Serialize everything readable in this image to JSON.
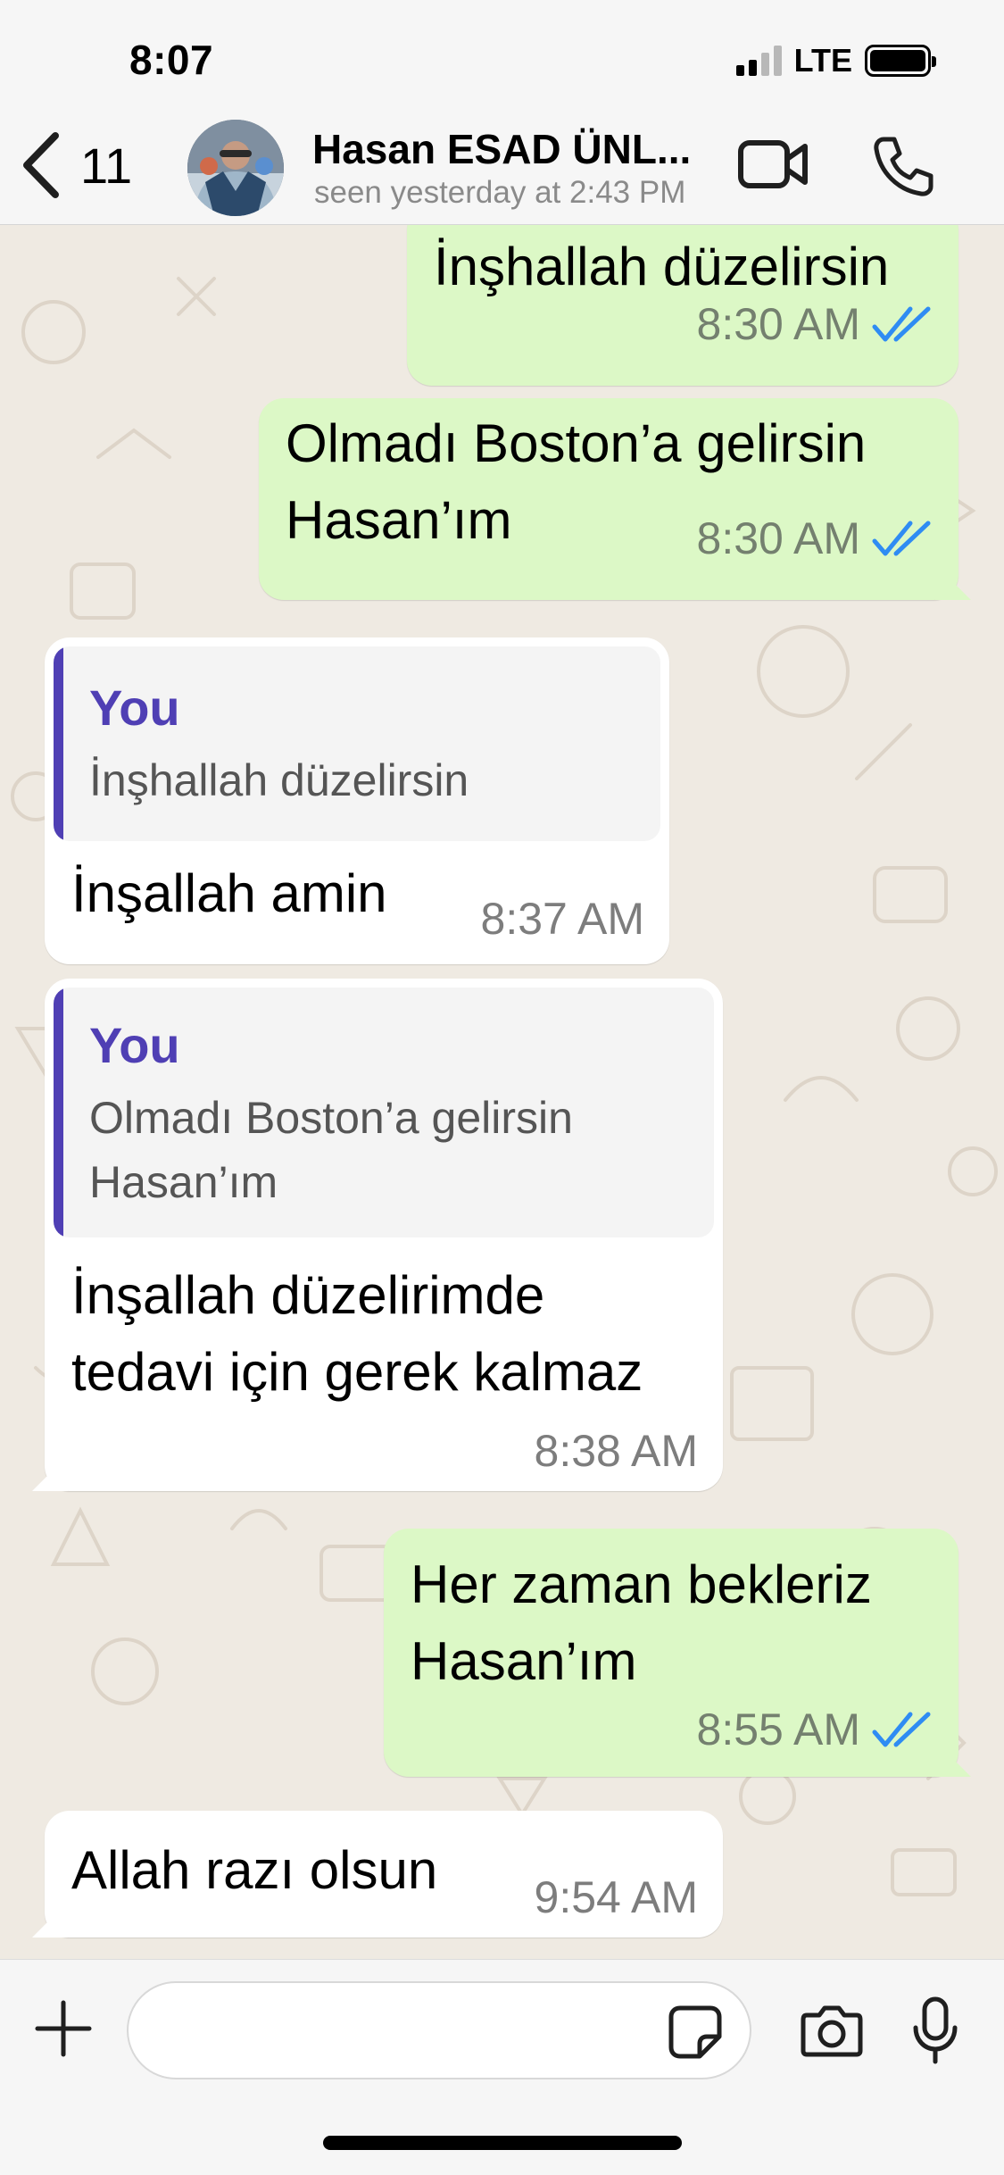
{
  "status_bar": {
    "time": "8:07",
    "network": "LTE"
  },
  "header": {
    "back_count": "11",
    "contact_name": "Hasan ESAD ÜNL...",
    "contact_status": "seen yesterday at 2:43 PM"
  },
  "messages": [
    {
      "direction": "out",
      "lines": [
        "İnşhallah düzelirsin"
      ],
      "time": "8:30 AM",
      "read": true
    },
    {
      "direction": "out",
      "lines": [
        "Olmadı Boston’a gelirsin",
        "Hasan’ım"
      ],
      "time": "8:30 AM",
      "read": true
    },
    {
      "direction": "in",
      "quote": {
        "author": "You",
        "lines": [
          "İnşhallah düzelirsin"
        ]
      },
      "lines": [
        "İnşallah amin"
      ],
      "time": "8:37 AM"
    },
    {
      "direction": "in",
      "quote": {
        "author": "You",
        "lines": [
          "Olmadı Boston’a gelirsin",
          "Hasan’ım"
        ]
      },
      "lines": [
        "İnşallah düzelirimde",
        "tedavi için gerek kalmaz"
      ],
      "time": "8:38 AM"
    },
    {
      "direction": "out",
      "lines": [
        "Her zaman bekleriz",
        "Hasan’ım"
      ],
      "time": "8:55 AM",
      "read": true
    },
    {
      "direction": "in",
      "lines": [
        "Allah razı olsun"
      ],
      "time": "9:54 AM"
    }
  ],
  "input": {
    "value": "",
    "placeholder": ""
  },
  "colors": {
    "outgoing_bubble": "#dcf8c6",
    "incoming_bubble": "#ffffff",
    "chat_background": "#efeae2",
    "quote_accent": "#4f3fb4",
    "read_tick": "#2f8cf3",
    "header_icon": "#1f1f1f"
  },
  "icons": {
    "back": "chevron-left-icon",
    "video": "video-camera-icon",
    "call": "phone-icon",
    "attach": "plus-icon",
    "sticker": "sticker-icon",
    "camera": "camera-icon",
    "mic": "microphone-icon",
    "read": "double-check-icon"
  }
}
